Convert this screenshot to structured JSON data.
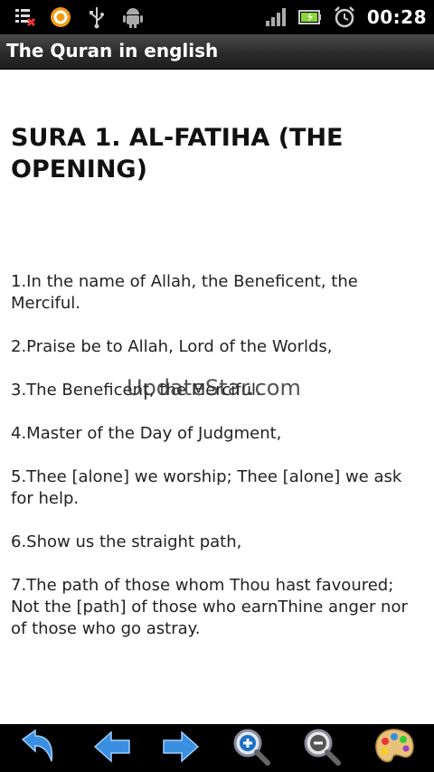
{
  "status_bar": {
    "time": "00:28",
    "left_icons": [
      "notification-icon",
      "app-circle-icon",
      "usb-icon",
      "android-debug-icon"
    ],
    "right_icons": [
      "signal-icon",
      "battery-icon",
      "alarm-clock-icon"
    ]
  },
  "app": {
    "title": "The Quran in english"
  },
  "content": {
    "sura_title": "SURA 1. AL-FATIHA (THE OPENING)",
    "verses": [
      "1.In the name of Allah, the Beneficent, the Merciful.",
      "2.Praise be to Allah, Lord of the Worlds,",
      "3.The Beneficent, the Merciful.",
      "4.Master of the Day of Judgment,",
      "5.Thee [alone] we worship; Thee [alone] we ask for help.",
      "6.Show us the straight path,",
      "7.The path of those whom Thou hast favoured; Not the [path] of those who earnThine anger nor of those who go astray."
    ],
    "watermark": "UpdateStar.com"
  },
  "toolbar": {
    "buttons": [
      "undo-icon",
      "arrow-left-icon",
      "arrow-right-icon",
      "zoom-in-icon",
      "zoom-out-icon",
      "palette-icon"
    ]
  },
  "colors": {
    "accent_blue": "#3a8fe0",
    "title_bar": "#2a2a2a",
    "status_bar": "#000000"
  }
}
